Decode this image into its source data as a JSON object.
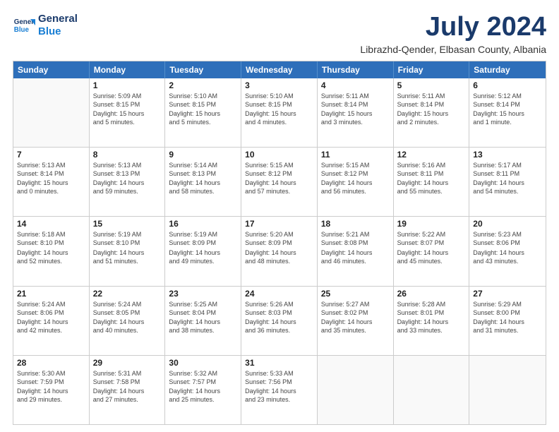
{
  "logo": {
    "line1": "General",
    "line2": "Blue"
  },
  "header": {
    "month": "July 2024",
    "location": "Librazhd-Qender, Elbasan County, Albania"
  },
  "weekdays": [
    "Sunday",
    "Monday",
    "Tuesday",
    "Wednesday",
    "Thursday",
    "Friday",
    "Saturday"
  ],
  "rows": [
    [
      {
        "day": "",
        "sunrise": "",
        "sunset": "",
        "daylight": ""
      },
      {
        "day": "1",
        "sunrise": "Sunrise: 5:09 AM",
        "sunset": "Sunset: 8:15 PM",
        "daylight": "Daylight: 15 hours and 5 minutes."
      },
      {
        "day": "2",
        "sunrise": "Sunrise: 5:10 AM",
        "sunset": "Sunset: 8:15 PM",
        "daylight": "Daylight: 15 hours and 5 minutes."
      },
      {
        "day": "3",
        "sunrise": "Sunrise: 5:10 AM",
        "sunset": "Sunset: 8:15 PM",
        "daylight": "Daylight: 15 hours and 4 minutes."
      },
      {
        "day": "4",
        "sunrise": "Sunrise: 5:11 AM",
        "sunset": "Sunset: 8:14 PM",
        "daylight": "Daylight: 15 hours and 3 minutes."
      },
      {
        "day": "5",
        "sunrise": "Sunrise: 5:11 AM",
        "sunset": "Sunset: 8:14 PM",
        "daylight": "Daylight: 15 hours and 2 minutes."
      },
      {
        "day": "6",
        "sunrise": "Sunrise: 5:12 AM",
        "sunset": "Sunset: 8:14 PM",
        "daylight": "Daylight: 15 hours and 1 minute."
      }
    ],
    [
      {
        "day": "7",
        "sunrise": "Sunrise: 5:13 AM",
        "sunset": "Sunset: 8:14 PM",
        "daylight": "Daylight: 15 hours and 0 minutes."
      },
      {
        "day": "8",
        "sunrise": "Sunrise: 5:13 AM",
        "sunset": "Sunset: 8:13 PM",
        "daylight": "Daylight: 14 hours and 59 minutes."
      },
      {
        "day": "9",
        "sunrise": "Sunrise: 5:14 AM",
        "sunset": "Sunset: 8:13 PM",
        "daylight": "Daylight: 14 hours and 58 minutes."
      },
      {
        "day": "10",
        "sunrise": "Sunrise: 5:15 AM",
        "sunset": "Sunset: 8:12 PM",
        "daylight": "Daylight: 14 hours and 57 minutes."
      },
      {
        "day": "11",
        "sunrise": "Sunrise: 5:15 AM",
        "sunset": "Sunset: 8:12 PM",
        "daylight": "Daylight: 14 hours and 56 minutes."
      },
      {
        "day": "12",
        "sunrise": "Sunrise: 5:16 AM",
        "sunset": "Sunset: 8:11 PM",
        "daylight": "Daylight: 14 hours and 55 minutes."
      },
      {
        "day": "13",
        "sunrise": "Sunrise: 5:17 AM",
        "sunset": "Sunset: 8:11 PM",
        "daylight": "Daylight: 14 hours and 54 minutes."
      }
    ],
    [
      {
        "day": "14",
        "sunrise": "Sunrise: 5:18 AM",
        "sunset": "Sunset: 8:10 PM",
        "daylight": "Daylight: 14 hours and 52 minutes."
      },
      {
        "day": "15",
        "sunrise": "Sunrise: 5:19 AM",
        "sunset": "Sunset: 8:10 PM",
        "daylight": "Daylight: 14 hours and 51 minutes."
      },
      {
        "day": "16",
        "sunrise": "Sunrise: 5:19 AM",
        "sunset": "Sunset: 8:09 PM",
        "daylight": "Daylight: 14 hours and 49 minutes."
      },
      {
        "day": "17",
        "sunrise": "Sunrise: 5:20 AM",
        "sunset": "Sunset: 8:09 PM",
        "daylight": "Daylight: 14 hours and 48 minutes."
      },
      {
        "day": "18",
        "sunrise": "Sunrise: 5:21 AM",
        "sunset": "Sunset: 8:08 PM",
        "daylight": "Daylight: 14 hours and 46 minutes."
      },
      {
        "day": "19",
        "sunrise": "Sunrise: 5:22 AM",
        "sunset": "Sunset: 8:07 PM",
        "daylight": "Daylight: 14 hours and 45 minutes."
      },
      {
        "day": "20",
        "sunrise": "Sunrise: 5:23 AM",
        "sunset": "Sunset: 8:06 PM",
        "daylight": "Daylight: 14 hours and 43 minutes."
      }
    ],
    [
      {
        "day": "21",
        "sunrise": "Sunrise: 5:24 AM",
        "sunset": "Sunset: 8:06 PM",
        "daylight": "Daylight: 14 hours and 42 minutes."
      },
      {
        "day": "22",
        "sunrise": "Sunrise: 5:24 AM",
        "sunset": "Sunset: 8:05 PM",
        "daylight": "Daylight: 14 hours and 40 minutes."
      },
      {
        "day": "23",
        "sunrise": "Sunrise: 5:25 AM",
        "sunset": "Sunset: 8:04 PM",
        "daylight": "Daylight: 14 hours and 38 minutes."
      },
      {
        "day": "24",
        "sunrise": "Sunrise: 5:26 AM",
        "sunset": "Sunset: 8:03 PM",
        "daylight": "Daylight: 14 hours and 36 minutes."
      },
      {
        "day": "25",
        "sunrise": "Sunrise: 5:27 AM",
        "sunset": "Sunset: 8:02 PM",
        "daylight": "Daylight: 14 hours and 35 minutes."
      },
      {
        "day": "26",
        "sunrise": "Sunrise: 5:28 AM",
        "sunset": "Sunset: 8:01 PM",
        "daylight": "Daylight: 14 hours and 33 minutes."
      },
      {
        "day": "27",
        "sunrise": "Sunrise: 5:29 AM",
        "sunset": "Sunset: 8:00 PM",
        "daylight": "Daylight: 14 hours and 31 minutes."
      }
    ],
    [
      {
        "day": "28",
        "sunrise": "Sunrise: 5:30 AM",
        "sunset": "Sunset: 7:59 PM",
        "daylight": "Daylight: 14 hours and 29 minutes."
      },
      {
        "day": "29",
        "sunrise": "Sunrise: 5:31 AM",
        "sunset": "Sunset: 7:58 PM",
        "daylight": "Daylight: 14 hours and 27 minutes."
      },
      {
        "day": "30",
        "sunrise": "Sunrise: 5:32 AM",
        "sunset": "Sunset: 7:57 PM",
        "daylight": "Daylight: 14 hours and 25 minutes."
      },
      {
        "day": "31",
        "sunrise": "Sunrise: 5:33 AM",
        "sunset": "Sunset: 7:56 PM",
        "daylight": "Daylight: 14 hours and 23 minutes."
      },
      {
        "day": "",
        "sunrise": "",
        "sunset": "",
        "daylight": ""
      },
      {
        "day": "",
        "sunrise": "",
        "sunset": "",
        "daylight": ""
      },
      {
        "day": "",
        "sunrise": "",
        "sunset": "",
        "daylight": ""
      }
    ]
  ]
}
